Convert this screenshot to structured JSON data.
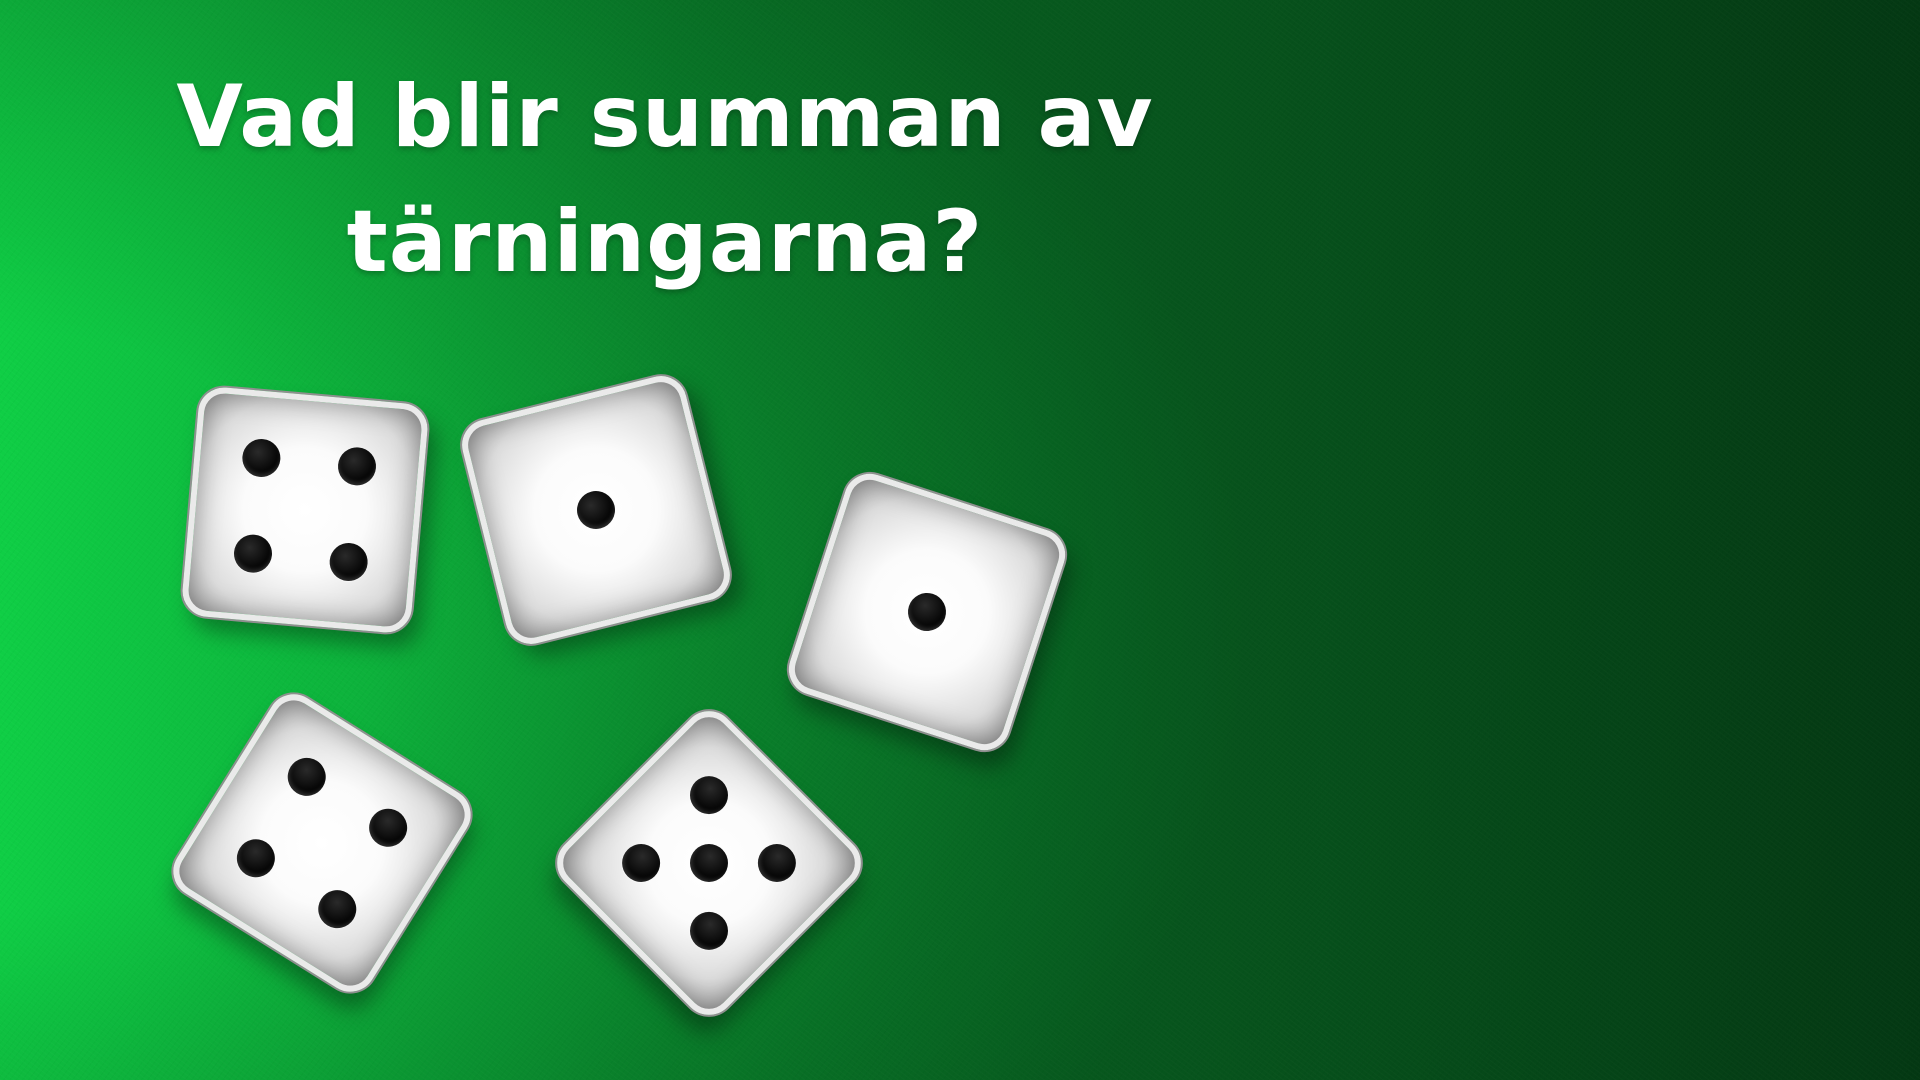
{
  "question": {
    "line_1": "Vad blir summan av",
    "line_2": "tärningarna?"
  },
  "dice": [
    {
      "value": 4
    },
    {
      "value": 1
    },
    {
      "value": 1
    },
    {
      "value": 4
    },
    {
      "value": 5
    }
  ],
  "colors": {
    "felt_light": "#0fce45",
    "felt_dark": "#06561d",
    "text": "#ffffff",
    "die_face": "#ffffff",
    "pip": "#000000"
  }
}
